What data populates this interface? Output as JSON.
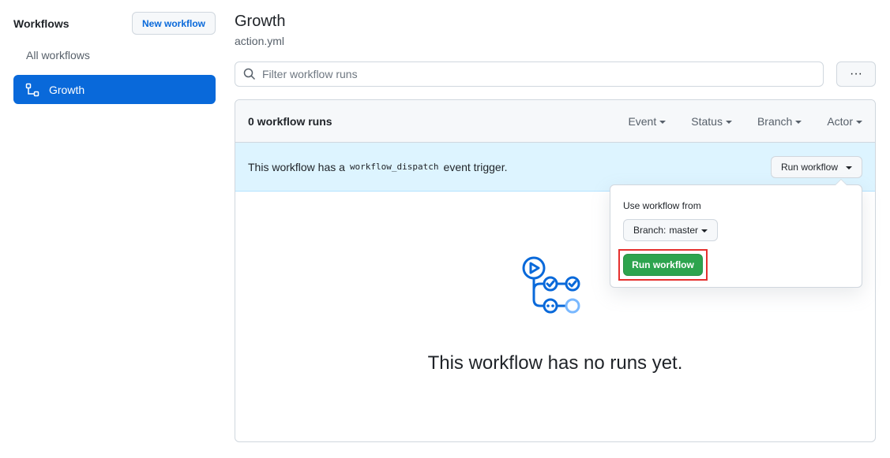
{
  "sidebar": {
    "title": "Workflows",
    "new_workflow_label": "New workflow",
    "all_workflows_label": "All workflows",
    "items": [
      {
        "label": "Growth",
        "active": true,
        "icon": "workflow-icon"
      }
    ]
  },
  "main": {
    "title": "Growth",
    "subtitle": "action.yml",
    "filter": {
      "placeholder": "Filter workflow runs",
      "value": ""
    },
    "more_button": "···",
    "runs_count": "0 workflow runs",
    "filters": [
      "Event",
      "Status",
      "Branch",
      "Actor"
    ],
    "banner": {
      "text_before": "This workflow has a",
      "code": "workflow_dispatch",
      "text_after": "event trigger.",
      "run_button": "Run workflow"
    },
    "empty_state": {
      "icon": "workflow-runs-illustration-icon",
      "message": "This workflow has no runs yet."
    },
    "popover": {
      "label": "Use workflow from",
      "branch_prefix": "Branch:",
      "branch_value": "master",
      "run_button": "Run workflow"
    }
  },
  "colors": {
    "accent": "#0969da",
    "banner_bg": "#ddf4ff",
    "success": "#2da44e",
    "highlight": "#e5302e"
  }
}
